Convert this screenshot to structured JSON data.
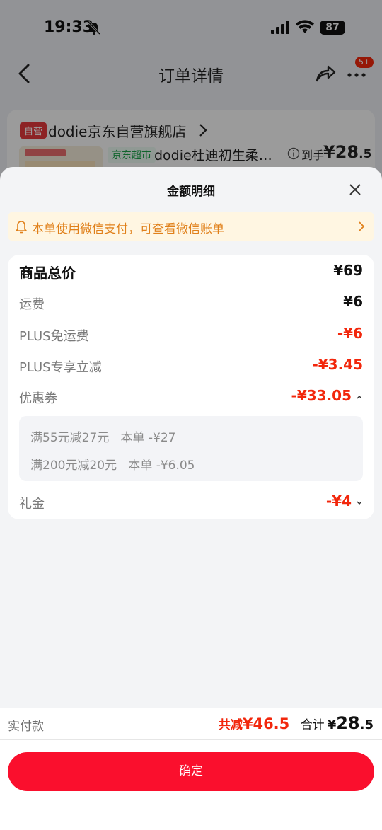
{
  "status_bar": {
    "time": "19:33",
    "battery": "87"
  },
  "nav": {
    "title": "订单详情",
    "badge": "5+"
  },
  "order": {
    "self_tag": "自营",
    "shop_name": "dodie京东自营旗舰店",
    "chaoshi_tag": "京东超市",
    "product_name": "dodie杜迪初生柔…",
    "to_hand_label": "到手",
    "to_hand_price_int": "¥28",
    "to_hand_price_dec": ".5"
  },
  "sheet": {
    "title": "金额明细",
    "banner_text": "本单使用微信支付，可查看微信账单"
  },
  "details": {
    "total_label": "商品总价",
    "total_value": "¥69",
    "shipping_label": "运费",
    "shipping_value": "¥6",
    "plus_free_label": "PLUS免运费",
    "plus_free_value": "-¥6",
    "plus_discount_label": "PLUS专享立减",
    "plus_discount_value": "-¥3.45",
    "coupon_label": "优惠券",
    "coupon_value": "-¥33.05",
    "coupons": [
      "满55元减27元   本单 -¥27",
      "满200元减20元   本单 -¥6.05"
    ],
    "gift_label": "礼金",
    "gift_value": "-¥4"
  },
  "footer": {
    "actual_label": "实付款",
    "discount_label": "共减",
    "discount_value": "¥46.5",
    "sum_label": "合计",
    "sum_currency": "¥",
    "sum_int": "28",
    "sum_dec": ".5",
    "confirm_label": "确定"
  },
  "colors": {
    "accent_red": "#f2270c",
    "button_red": "#fa0f2d",
    "banner_orange": "#e0801a"
  }
}
